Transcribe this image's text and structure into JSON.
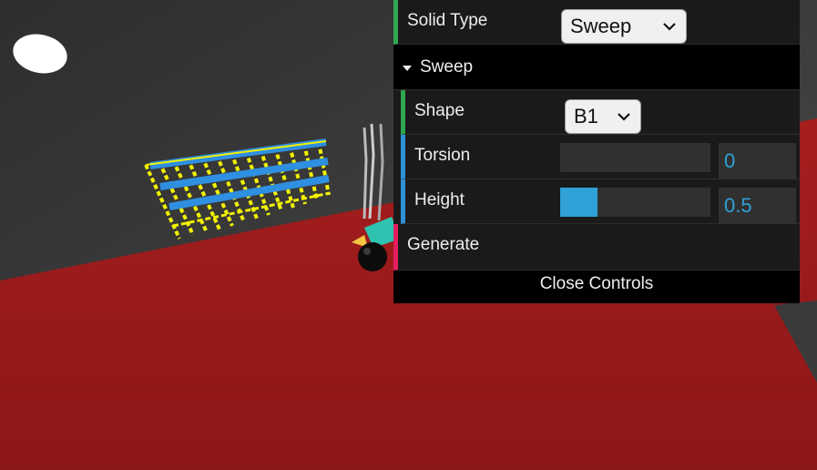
{
  "gui": {
    "solid_type": {
      "label": "Solid Type",
      "value": "Sweep"
    },
    "folder": {
      "title": "Sweep"
    },
    "shape": {
      "label": "Shape",
      "value": "B1"
    },
    "torsion": {
      "label": "Torsion",
      "value": "0",
      "level": 0.0
    },
    "height": {
      "label": "Height",
      "value": "0.5",
      "level": 0.25
    },
    "generate": {
      "label": "Generate"
    },
    "close": {
      "label": "Close Controls"
    }
  },
  "colors": {
    "floor": "#a01c1c",
    "wall": "#3c3c3c",
    "accent_green": "#2fa84f",
    "accent_blue": "#2f91d6",
    "accent_pink": "#e61d5f",
    "slider_fill": "#2fa1d6"
  }
}
